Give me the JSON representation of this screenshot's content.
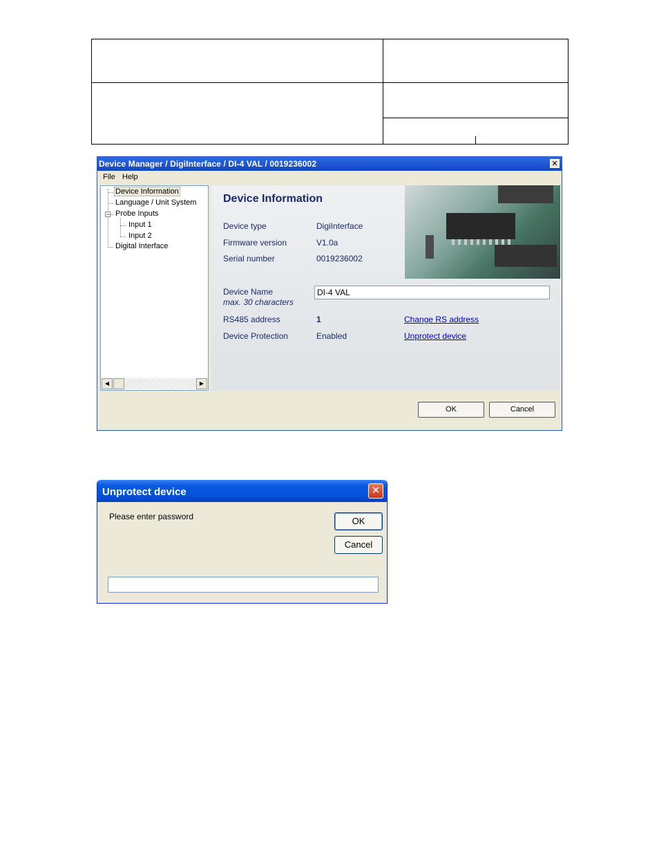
{
  "device_manager": {
    "title": "Device Manager / DigiInterface / DI-4 VAL / 0019236002",
    "close_glyph": "✕",
    "menu": {
      "file": "File",
      "help": "Help"
    },
    "tree": {
      "device_information": "Device Information",
      "language_unit_system": "Language / Unit System",
      "probe_inputs": "Probe Inputs",
      "input_1": "Input  1",
      "input_2": "Input  2",
      "digital_interface": "Digital Interface"
    },
    "panel": {
      "heading": "Device Information",
      "device_type_label": "Device type",
      "device_type_value": "DigiInterface",
      "firmware_label": "Firmware version",
      "firmware_value": "V1.0a",
      "serial_label": "Serial number",
      "serial_value": "0019236002",
      "device_name_label": "Device Name",
      "device_name_note": "max. 30 characters",
      "device_name_value": "DI-4 VAL",
      "rs485_label": "RS485 address",
      "rs485_value": "1",
      "change_rs_link": "Change RS address",
      "protection_label": "Device Protection",
      "protection_value": "Enabled",
      "unprotect_link": "Unprotect device"
    },
    "buttons": {
      "ok": "OK",
      "cancel": "Cancel"
    }
  },
  "unprotect_dialog": {
    "title": "Unprotect device",
    "close_glyph": "✕",
    "prompt": "Please enter password",
    "ok": "OK",
    "cancel": "Cancel",
    "password_value": ""
  }
}
